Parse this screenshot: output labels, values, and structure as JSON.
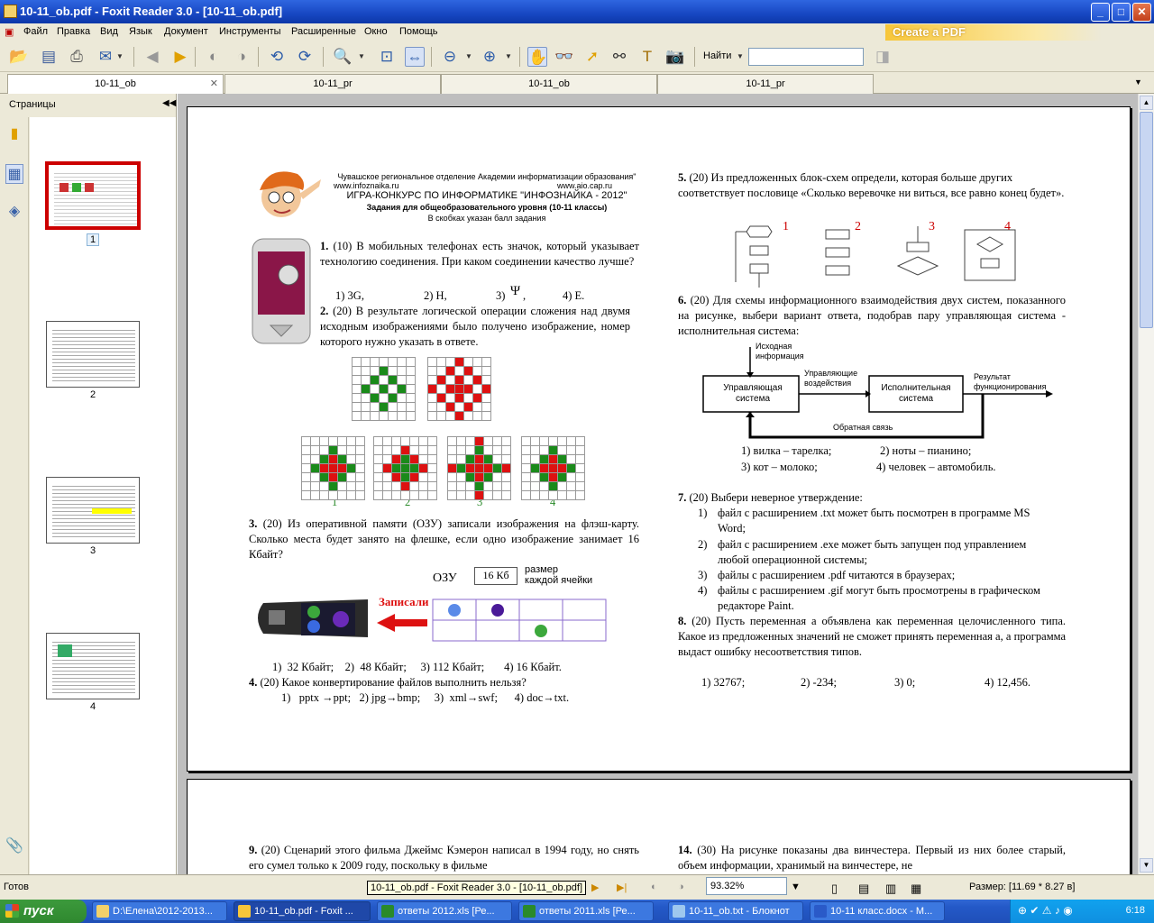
{
  "window": {
    "title": "10-11_ob.pdf - Foxit Reader 3.0 - [10-11_ob.pdf]",
    "min": "_",
    "max": "□",
    "close": "✕"
  },
  "menu": [
    "Файл",
    "Правка",
    "Вид",
    "Язык",
    "Документ",
    "Инструменты",
    "Расширенные",
    "Окно",
    "Помощь"
  ],
  "create_pdf": "Create a PDF",
  "toolbar": {
    "find_label": "Найти",
    "find_value": ""
  },
  "tabs": [
    "10-11_ob",
    "10-11_pr",
    "10-11_ob",
    "10-11_pr"
  ],
  "sidebar": {
    "title": "Страницы",
    "thumbs": [
      "1",
      "2",
      "3",
      "4"
    ]
  },
  "page1": {
    "header": {
      "l1": "Чувашское региональное отделение Академии информатизации образования\"",
      "l2": "www.infoznaika.ru",
      "l3": "www.aio.cap.ru",
      "l4": "ИГРА-КОНКУРС ПО ИНФОРМАТИКЕ \"ИНФОЗНАЙКА - 2012\"",
      "l5": "Задания для общеобразовательного уровня (10-11 классы)",
      "l6": "В скобках указан балл задания"
    },
    "q1": {
      "n": "1.",
      "text": "(10) В мобильных телефонах есть значок, который указывает технологию соединения. При каком соединении качество лучше?",
      "a1": "1)   3G,",
      "a2": "2) H,",
      "a3": "3)",
      "a4": "4) E."
    },
    "q2": {
      "n": "2.",
      "text": "(20) В результате логической операции сложения над двумя исходным изображениями было получено изображение, номер которого нужно указать в ответе.",
      "labels": [
        "1",
        "2",
        "3",
        "4"
      ]
    },
    "q3": {
      "n": "3.",
      "text": "(20) Из оперативной памяти (ОЗУ) записали изображения на флэш-карту. Сколько места будет занято на флешке, если одно изображение занимает 16 Кбайт?",
      "ozu": "ОЗУ",
      "cellsize": "16 Кб",
      "cellsize_note1": "размер",
      "cellsize_note2": "каждой ячейки",
      "arrow_label": "Записали",
      "answers": "1)  32 Кбайт;    2)  48 Кбайт;     3) 112 Кбайт;       4) 16 Кбайт."
    },
    "q4": {
      "n": "4.",
      "text": "(20) Какое конвертирование файлов выполнить нельзя?",
      "answers": "1)   pptx →ppt;   2) jpg→bmp;     3)  xml→swf;      4) doc→txt."
    },
    "q5": {
      "n": "5.",
      "text": "(20) Из предложенных блок-схем определи, которая больше других соответствует пословице «Сколько веревочке ни виться, все равно конец будет».",
      "labels": [
        "1",
        "2",
        "3",
        "4"
      ]
    },
    "q6": {
      "n": "6.",
      "text": "(20) Для схемы информационного взаимодействия двух систем, показанного на рисунке, выбери вариант ответа, подобрав пару управляющая система - исполнительная система:",
      "d_in": "Исходная информация",
      "d_ctrl": "Управляющая система",
      "d_act": "Управляющие воздействия",
      "d_exec": "Исполнительная система",
      "d_res": "Результат функционирования",
      "d_fb": "Обратная связь",
      "a1": "1) вилка – тарелка;",
      "a2": "2) ноты – пианино;",
      "a3": "3) кот – молоко;",
      "a4": "4) человек – автомобиль."
    },
    "q7": {
      "n": "7.",
      "text": "(20) Выбери неверное утверждение:",
      "items": [
        {
          "n": "1)",
          "t": "файл с расширением .txt  может быть посмотрен в программе MS Word;"
        },
        {
          "n": "2)",
          "t": "файл с расширением .exe может быть запущен под управлением любой операционной системы;"
        },
        {
          "n": "3)",
          "t": "файлы с расширением .pdf читаются в браузерах;"
        },
        {
          "n": "4)",
          "t": "файлы с расширением  .gif  могут быть просмотрены в графическом редакторе Paint."
        }
      ]
    },
    "q8": {
      "n": "8.",
      "text": "(20) Пусть переменная а объявлена как переменная целочисленного типа. Какое из предложенных значений не сможет принять переменная а, а программа выдаст ошибку несоответствия типов.",
      "a1": "1) 32767;",
      "a2": "2) -234;",
      "a3": "3) 0;",
      "a4": "4) 12,456."
    }
  },
  "page2": {
    "q9": {
      "n": "9.",
      "text": "(20) Сценарий этого фильма Джеймс Кэмерон написал в 1994 году, но снять его сумел только к 2009 году, поскольку в фильме"
    },
    "q14": {
      "n": "14.",
      "text": "(30) На рисунке показаны два винчестера. Первый из них более старый, объем информации, хранимый на винчестере, не"
    }
  },
  "status": {
    "ready": "Готов",
    "tooltip": "10-11_ob.pdf - Foxit Reader 3.0 - [10-11_ob.pdf]",
    "zoom": "93.32%",
    "size": "Размер: [11.69 * 8.27 в]"
  },
  "taskbar": {
    "start": "пуск",
    "items": [
      "D:\\Елена\\2012-2013...",
      "10-11_ob.pdf - Foxit ...",
      "ответы 2012.xls  [Ре...",
      "ответы 2011.xls  [Ре...",
      "10-11_ob.txt - Блокнот",
      "10-11 класс.docx - M..."
    ],
    "clock": "6:18"
  }
}
